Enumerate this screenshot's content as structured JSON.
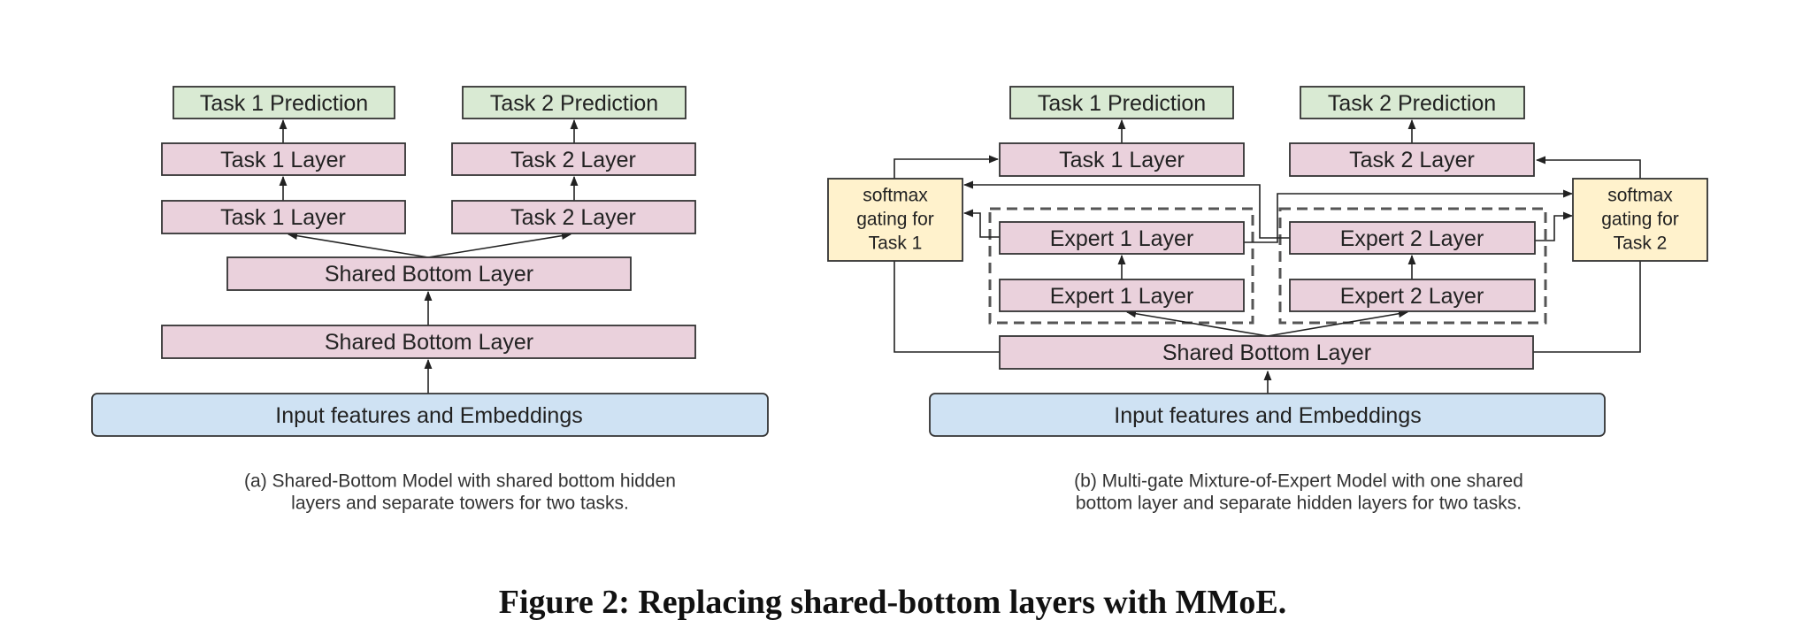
{
  "colors": {
    "layer_fill": "#ead1dc",
    "prediction_fill": "#d9ead3",
    "gate_fill": "#fff2cc",
    "input_fill": "#cfe2f3",
    "border": "#333333"
  },
  "panel_a": {
    "task1_prediction": "Task 1 Prediction",
    "task2_prediction": "Task 2 Prediction",
    "task1_layer_top": "Task 1 Layer",
    "task2_layer_top": "Task 2 Layer",
    "task1_layer_bottom": "Task 1 Layer",
    "task2_layer_bottom": "Task 2 Layer",
    "shared_bottom_upper": "Shared Bottom Layer",
    "shared_bottom_lower": "Shared Bottom Layer",
    "input": "Input features and Embeddings",
    "caption_line1": "(a) Shared-Bottom Model with shared bottom hidden",
    "caption_line2": "layers and separate towers for two tasks."
  },
  "panel_b": {
    "task1_prediction": "Task 1 Prediction",
    "task2_prediction": "Task 2 Prediction",
    "task1_layer": "Task 1 Layer",
    "task2_layer": "Task 2 Layer",
    "gate1_lines": [
      "softmax",
      "gating for",
      "Task 1"
    ],
    "gate2_lines": [
      "softmax",
      "gating for",
      "Task 2"
    ],
    "expert1_upper": "Expert 1 Layer",
    "expert1_lower": "Expert 1 Layer",
    "expert2_upper": "Expert 2 Layer",
    "expert2_lower": "Expert 2 Layer",
    "shared_bottom": "Shared Bottom Layer",
    "input": "Input features and Embeddings",
    "caption_line1": "(b) Multi-gate Mixture-of-Expert Model with one shared",
    "caption_line2": "bottom layer and separate hidden layers for two tasks."
  },
  "figure_caption": "Figure 2: Replacing shared-bottom layers with MMoE."
}
